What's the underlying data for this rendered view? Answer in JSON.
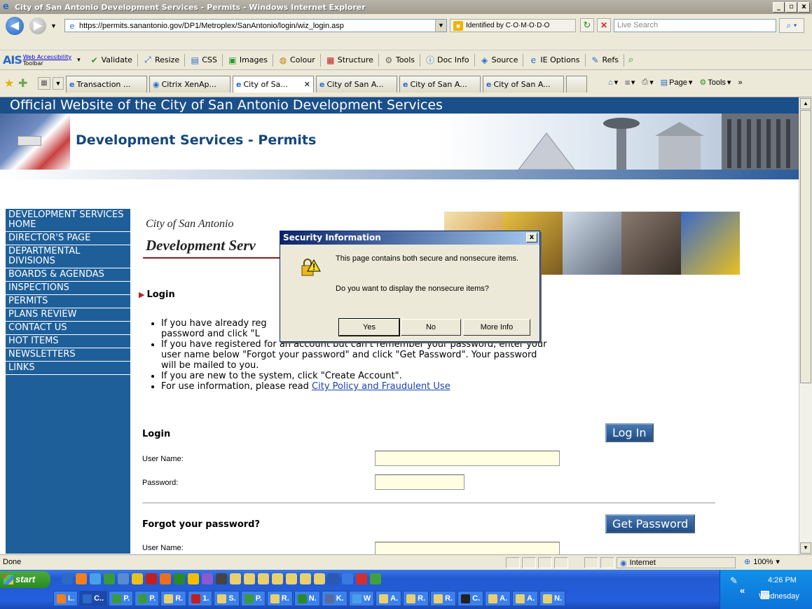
{
  "window": {
    "title": "City of San Antonio Development Services - Permits - Windows Internet Explorer",
    "min": "_",
    "max": "▫",
    "close": "x"
  },
  "address_bar": {
    "url": "https://permits.sanantonio.gov/DP1/Metroplex/SanAntonio/login/wiz_login.asp",
    "identity": "Identified by C·O·M·O·D·O",
    "search_placeholder": "Live Search"
  },
  "ais_toolbar": {
    "logo": "AIS",
    "sub_link": "Web Accessibility",
    "sub_text": "Toolbar",
    "items": [
      "Validate",
      "Resize",
      "CSS",
      "Images",
      "Colour",
      "Structure",
      "Tools",
      "Doc Info",
      "Source",
      "IE Options",
      "Refs"
    ]
  },
  "tabs": [
    {
      "label": "Transaction ...",
      "active": false
    },
    {
      "label": "Citrix XenAp...",
      "active": false
    },
    {
      "label": "City of Sa...",
      "active": true
    },
    {
      "label": "City of San A...",
      "active": false
    },
    {
      "label": "City of San A...",
      "active": false
    },
    {
      "label": "City of San A...",
      "active": false
    }
  ],
  "command_bar": {
    "page": "Page",
    "tools": "Tools"
  },
  "site": {
    "title": "Official Website of the City of San Antonio Development Services",
    "banner_title": "Development Services - Permits",
    "logo_small": "City of San Antonio",
    "logo_big": "Development Serv"
  },
  "sidenav": [
    "DEVELOPMENT SERVICES HOME",
    "DIRECTOR'S PAGE",
    "DEPARTMENTAL DIVISIONS",
    "BOARDS & AGENDAS",
    "INSPECTIONS",
    "PERMITS",
    "PLANS REVIEW",
    "CONTACT US",
    "HOT ITEMS",
    "NEWSLETTERS",
    "LINKS"
  ],
  "login_section": {
    "heading": "Login",
    "bullets": {
      "b1a": "If you have already reg",
      "b1b": "password and click \"L",
      "b2": "If you have registered for an account but can't remember your password, enter your user name below \"Forgot your password\" and click \"Get Password\". Your password will be mailed to you.",
      "b3": "If you are new to the system, click \"Create Account\".",
      "b4_text": "For use information, please read ",
      "b4_link": "City Policy and Fraudulent Use"
    },
    "form_heading": "Login",
    "login_button": "Log In",
    "username_label": "User Name:",
    "password_label": "Password:",
    "forgot_heading": "Forgot your password?",
    "get_password_button": "Get Password",
    "forgot_username_label": "User Name:"
  },
  "dialog": {
    "title": "Security Information",
    "close": "x",
    "message": "This page contains both secure and nonsecure items.",
    "question": "Do you want to display the nonsecure items?",
    "yes": "Yes",
    "no": "No",
    "more": "More Info"
  },
  "status": {
    "text": "Done",
    "zone": "Internet",
    "zoom": "100%"
  },
  "taskbar": {
    "start": "start",
    "tasks": [
      "I..",
      "C..",
      "P.",
      "P.",
      "R.",
      "1.",
      "S.",
      "P.",
      "R.",
      "N.",
      "K.",
      "W",
      "A.",
      "R.",
      "R.",
      "C.",
      "A.",
      "A.",
      "N."
    ],
    "time": "4:26 PM",
    "day": "Wednesday"
  }
}
